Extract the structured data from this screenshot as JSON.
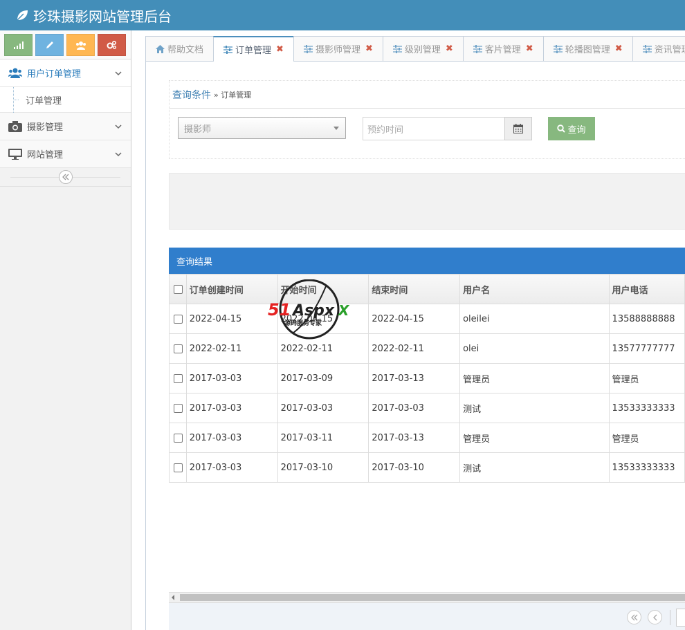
{
  "header": {
    "title": "珍珠摄影网站管理后台"
  },
  "sidebar": {
    "shortcuts": [
      {
        "icon": "signal-icon",
        "color": "#87b87f"
      },
      {
        "icon": "pencil-icon",
        "color": "#6fb3e0"
      },
      {
        "icon": "users-icon",
        "color": "#ffb752"
      },
      {
        "icon": "cogs-icon",
        "color": "#d15b47"
      }
    ],
    "items": [
      {
        "label": "用户订单管理",
        "icon": "users-icon",
        "active": true
      },
      {
        "label": "摄影管理",
        "icon": "camera-icon"
      },
      {
        "label": "网站管理",
        "icon": "desktop-icon"
      }
    ],
    "subitems": [
      {
        "label": "订单管理"
      }
    ]
  },
  "tabs": [
    {
      "label": "帮助文档",
      "icon": "home-icon",
      "closable": false
    },
    {
      "label": "订单管理",
      "icon": "sliders-icon",
      "closable": true,
      "active": true
    },
    {
      "label": "摄影师管理",
      "icon": "sliders-icon",
      "closable": true
    },
    {
      "label": "级别管理",
      "icon": "sliders-icon",
      "closable": true
    },
    {
      "label": "客片管理",
      "icon": "sliders-icon",
      "closable": true
    },
    {
      "label": "轮播图管理",
      "icon": "sliders-icon",
      "closable": true
    },
    {
      "label": "资讯管理",
      "icon": "sliders-icon",
      "closable": true
    }
  ],
  "query": {
    "title": "查询条件",
    "breadcrumb": "» 订单管理",
    "photographer_placeholder": "摄影师",
    "date_placeholder": "预约时间",
    "search_label": "查询"
  },
  "results": {
    "title": "查询结果",
    "columns": [
      "订单创建时间",
      "开始时间",
      "结束时间",
      "用户名",
      "用户电话"
    ],
    "rows": [
      [
        "2022-04-15",
        "2022-04-15",
        "2022-04-15",
        "oleilei",
        "13588888888"
      ],
      [
        "2022-02-11",
        "2022-02-11",
        "2022-02-11",
        "olei",
        "13577777777"
      ],
      [
        "2017-03-03",
        "2017-03-09",
        "2017-03-13",
        "管理员",
        "管理员"
      ],
      [
        "2017-03-03",
        "2017-03-03",
        "2017-03-03",
        "测试",
        "13533333333"
      ],
      [
        "2017-03-03",
        "2017-03-11",
        "2017-03-13",
        "管理员",
        "管理员"
      ],
      [
        "2017-03-03",
        "2017-03-10",
        "2017-03-10",
        "测试",
        "13533333333"
      ]
    ]
  },
  "watermark": {
    "brand_a": "51",
    "brand_b": "Aspx",
    "brand_c": "X",
    "slogan": "源码服务专家"
  },
  "colors": {
    "brand": "#438eb9",
    "accent": "#307ecc",
    "success": "#87b87f",
    "danger": "#d15b47"
  }
}
